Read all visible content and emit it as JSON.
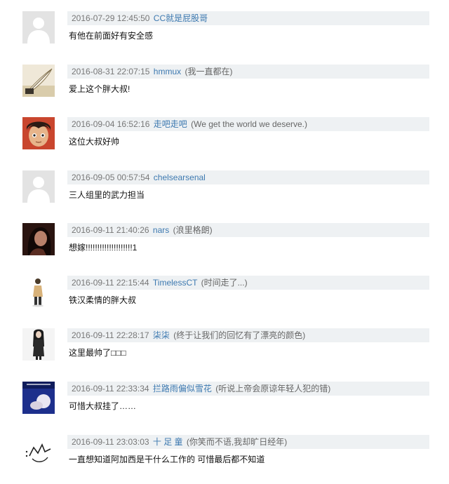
{
  "comments": [
    {
      "time": "2016-07-29 12:45:50",
      "user": "CC就是屁股哥",
      "sig": "",
      "text": "有他在前面好有安全感",
      "avatar": "default-avatar-icon"
    },
    {
      "time": "2016-08-31 22:07:15",
      "user": "hmmux",
      "sig": "(我一直都在)",
      "text": "爱上这个胖大叔!",
      "avatar": "quill-avatar"
    },
    {
      "time": "2016-09-04 16:52:16",
      "user": "走吧走吧",
      "sig": "(We get the world we deserve.)",
      "text": "这位大叔好帅",
      "avatar": "anime-boy-avatar"
    },
    {
      "time": "2016-09-05 00:57:54",
      "user": "chelsearsenal",
      "sig": "",
      "text": "三人组里的武力担当",
      "avatar": "default-avatar-icon"
    },
    {
      "time": "2016-09-11 21:40:26",
      "user": "nars",
      "sig": "(浪里格朗)",
      "text": "想嫁!!!!!!!!!!!!!!!!!!!!1",
      "avatar": "woman-portrait-avatar"
    },
    {
      "time": "2016-09-11 22:15:44",
      "user": "TimelessCT",
      "sig": "(时间走了...)",
      "text": "铁汉柔情的胖大叔",
      "avatar": "standing-figure-avatar"
    },
    {
      "time": "2016-09-11 22:28:17",
      "user": "柒柒",
      "sig": "(终于让我们的回忆有了漂亮的颜色)",
      "text": "这里最帅了□□□",
      "avatar": "girl-figure-avatar"
    },
    {
      "time": "2016-09-11 22:33:34",
      "user": "拦路雨偏似雪花",
      "sig": "(听说上帝会原谅年轻人犯的错)",
      "text": "可惜大叔挂了……",
      "avatar": "blue-book-avatar"
    },
    {
      "time": "2016-09-11 23:03:03",
      "user": "十 足 童",
      "sig": "(你笑而不语,我却旷日经年)",
      "text": "一直想知道阿加西是干什么工作的 可惜最后都不知道",
      "avatar": "sketch-hand-avatar"
    }
  ]
}
